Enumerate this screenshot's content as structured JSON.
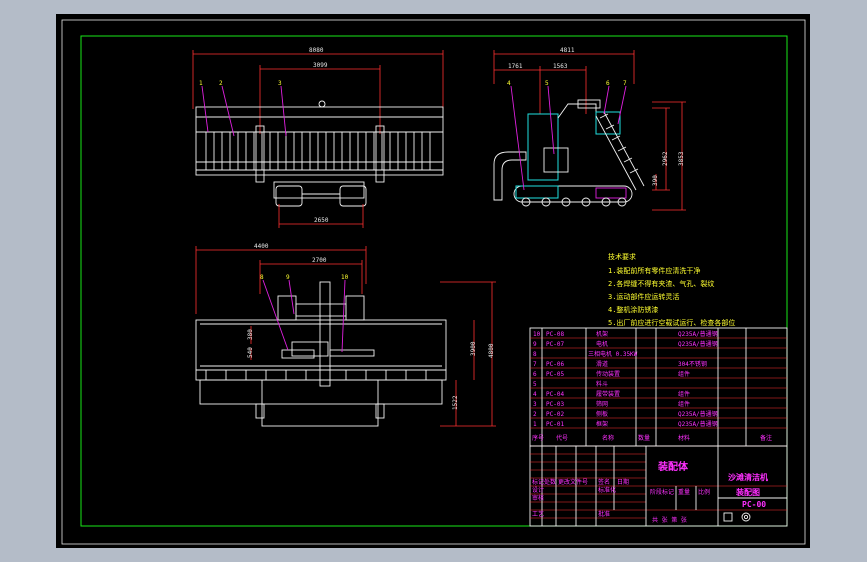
{
  "dimensions": {
    "front_total": "8080",
    "front_inner": "3099",
    "front_track": "2650",
    "side_total": "4811",
    "side_a": "1761",
    "side_b": "1563",
    "side_h1": "2962",
    "side_h2": "3853",
    "side_h3": "390",
    "top_total": "4400",
    "top_inner": "2700",
    "top_h1": "3900",
    "top_h2": "4800",
    "top_h3": "1522",
    "top_small1": "380",
    "top_small2": "540"
  },
  "callouts": {
    "c1": "1",
    "c2": "2",
    "c3": "3",
    "c4": "4",
    "c5": "5",
    "c6": "6",
    "c7": "7",
    "c8": "8",
    "c9": "9",
    "c10": "10"
  },
  "tech_requirements": {
    "title": "技术要求",
    "lines": [
      "1.装配前所有零件应清洗干净",
      "2.各焊缝不得有夹渣、气孔、裂纹",
      "3.运动部件应运转灵活",
      "4.整机涂防锈漆",
      "5.出厂前应进行空载试运行、检查各部位"
    ]
  },
  "parts_list": {
    "rows": [
      {
        "no": "10",
        "code": "PC-08",
        "name": "机架",
        "material": "Q235A/普通钢"
      },
      {
        "no": "9",
        "code": "PC-07",
        "name": "电机",
        "material": "Q235A/普通钢"
      },
      {
        "no": "8",
        "code": "",
        "name": "三相电机 0.35KW",
        "material": ""
      },
      {
        "no": "7",
        "code": "PC-06",
        "name": "滑道",
        "material": "304不锈钢"
      },
      {
        "no": "6",
        "code": "PC-05",
        "name": "传动装置",
        "material": "组件"
      },
      {
        "no": "5",
        "code": "",
        "name": "料斗",
        "material": ""
      },
      {
        "no": "4",
        "code": "PC-04",
        "name": "履带装置",
        "material": "组件"
      },
      {
        "no": "3",
        "code": "PC-03",
        "name": "筛网",
        "material": "组件"
      },
      {
        "no": "2",
        "code": "PC-02",
        "name": "侧板",
        "material": "Q235A/普通钢"
      },
      {
        "no": "1",
        "code": "PC-01",
        "name": "框架",
        "material": "Q235A/普通钢"
      }
    ],
    "header": {
      "no": "序号",
      "code": "代号",
      "name": "名称",
      "qty": "数量",
      "material": "材料",
      "note": "备注"
    }
  },
  "title_block": {
    "assembly_label": "装配体",
    "product_name": "沙滩清洁机",
    "drawing_name": "装配图",
    "drawing_code": "PC-00",
    "labels": {
      "mark": "标记",
      "zones": "处数",
      "change": "更改文件号",
      "sign": "签名",
      "date": "日期",
      "design": "设计",
      "check": "审核",
      "process": "工艺",
      "standard": "标准化",
      "approve": "批准",
      "stage": "阶段标记",
      "weight": "重量",
      "ratio": "比例",
      "sheets": "共 张 第 张"
    }
  }
}
